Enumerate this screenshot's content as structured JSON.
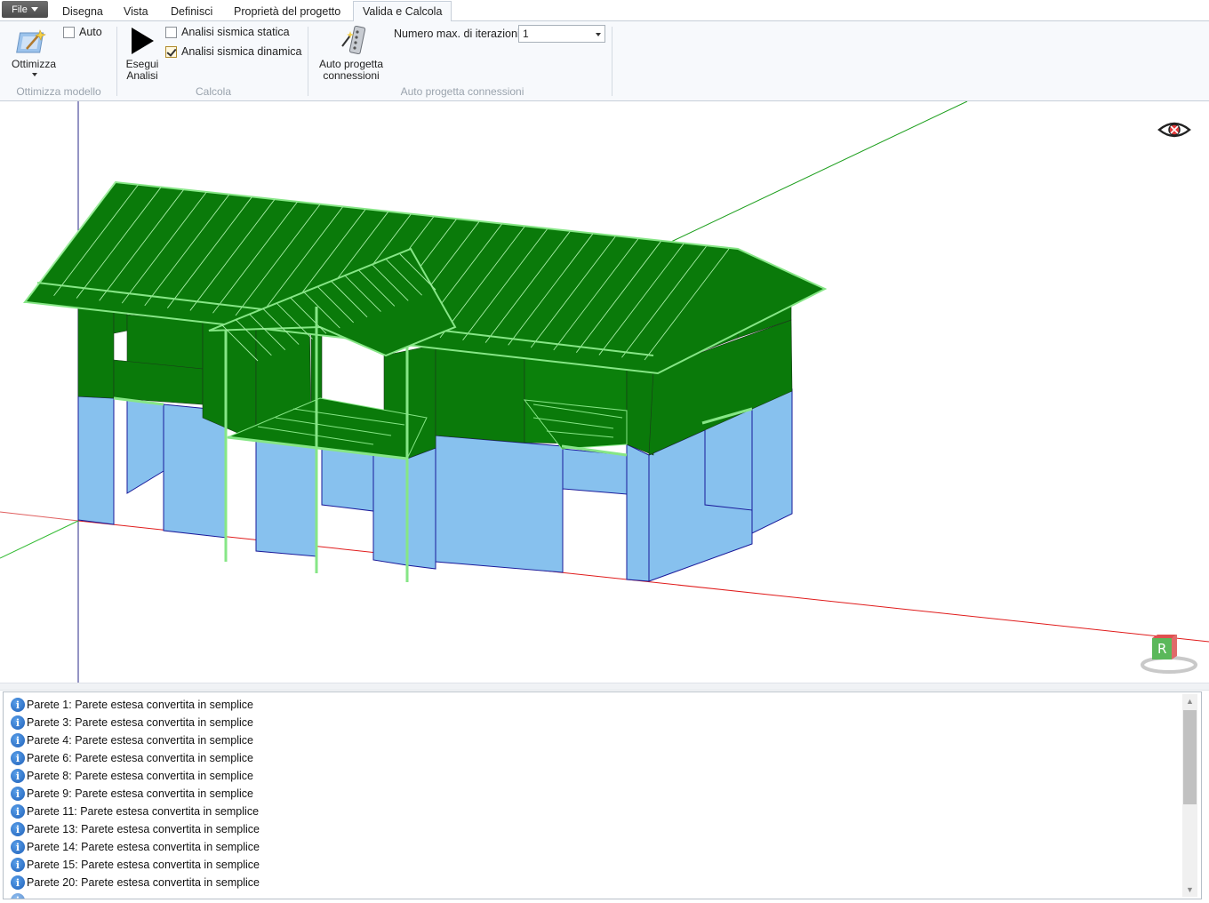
{
  "menu": {
    "file_label": "File",
    "tabs": [
      "Disegna",
      "Vista",
      "Definisci",
      "Proprietà del progetto",
      "Valida e Calcola"
    ],
    "active_tab": "Valida e Calcola"
  },
  "ribbon": {
    "ottimizza": {
      "button_label": "Ottimizza",
      "auto_label": "Auto",
      "auto_checked": false,
      "group_label": "Ottimizza modello"
    },
    "calcola": {
      "run_label_line1": "Esegui",
      "run_label_line2": "Analisi",
      "static_label": "Analisi sismica statica",
      "static_checked": false,
      "dynamic_label": "Analisi sismica dinamica",
      "dynamic_checked": true,
      "group_label": "Calcola"
    },
    "connessioni": {
      "button_line1": "Auto progetta",
      "button_line2": "connessioni",
      "iterations_label": "Numero max. di iterazioni",
      "iterations_value": "1",
      "group_label": "Auto progetta connessioni"
    }
  },
  "viewport": {
    "colors": {
      "roof": "#0a7a0a",
      "upper_wall": "#0a7a0a",
      "lower_wall": "#87c1ee",
      "edge": "#86e686",
      "axis_x": "#e01b1b",
      "axis_y": "#1b9e1b",
      "axis_z": "#1b1b9e"
    },
    "view_cube_label": "R"
  },
  "log": {
    "messages": [
      "Parete 1: Parete estesa convertita in semplice",
      "Parete 3: Parete estesa convertita in semplice",
      "Parete 4: Parete estesa convertita in semplice",
      "Parete 6: Parete estesa convertita in semplice",
      "Parete 8: Parete estesa convertita in semplice",
      "Parete 9: Parete estesa convertita in semplice",
      "Parete 11: Parete estesa convertita in semplice",
      "Parete 13: Parete estesa convertita in semplice",
      "Parete 14: Parete estesa convertita in semplice",
      "Parete 15: Parete estesa convertita in semplice",
      "Parete 20: Parete estesa convertita in semplice"
    ]
  }
}
